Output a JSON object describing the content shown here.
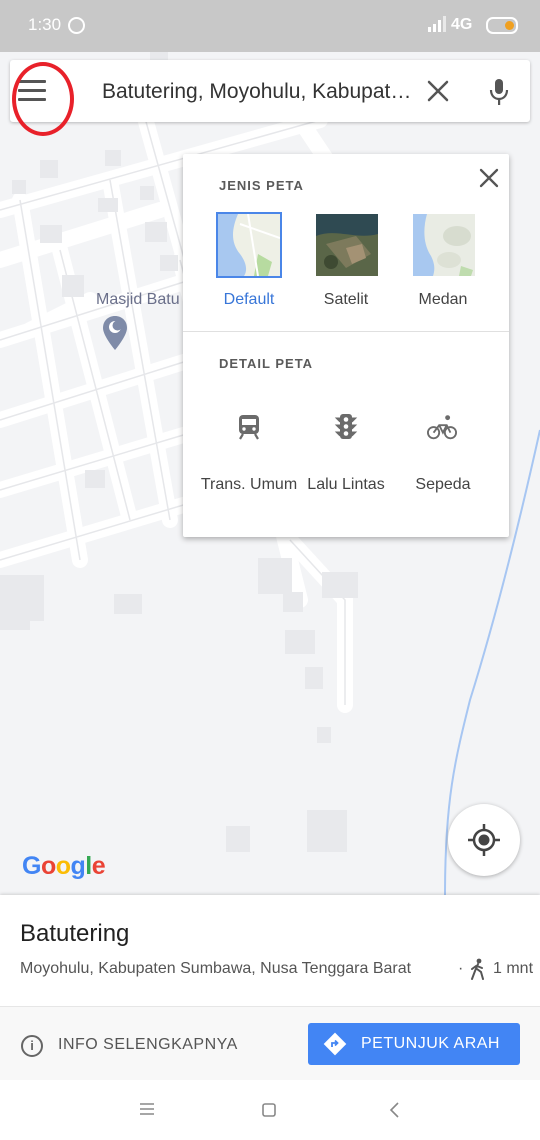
{
  "status_bar": {
    "time": "1:30",
    "network": "4G",
    "icons": [
      "hotspot-icon",
      "signal-icon",
      "battery-icon"
    ]
  },
  "search": {
    "query": "Batutering, Moyohulu, Kabupaten Sumbawa, Nusa Tenggara Barat",
    "icons": [
      "menu-icon",
      "close-icon",
      "mic-icon"
    ]
  },
  "map": {
    "poi_label": "Masjid Batu",
    "poi_icon": "mosque-pin-icon"
  },
  "layers_panel": {
    "map_type_title": "JENIS PETA",
    "map_types": [
      {
        "label": "Default",
        "selected": true
      },
      {
        "label": "Satelit",
        "selected": false
      },
      {
        "label": "Medan",
        "selected": false
      }
    ],
    "details_title": "DETAIL PETA",
    "details": [
      {
        "label": "Trans. Umum",
        "icon": "transit-icon"
      },
      {
        "label": "Lalu Lintas",
        "icon": "traffic-icon"
      },
      {
        "label": "Sepeda",
        "icon": "bicycle-icon"
      }
    ]
  },
  "google_logo": {
    "letters": [
      "G",
      "o",
      "o",
      "g",
      "l",
      "e"
    ],
    "colors": [
      "#4285F4",
      "#EA4335",
      "#FBBC05",
      "#4285F4",
      "#34A853",
      "#EA4335"
    ]
  },
  "place": {
    "title": "Batutering",
    "subtitle": "Moyohulu, Kabupaten Sumbawa, Nusa Tenggara Barat",
    "separator": "·",
    "walk_time": "1 mnt"
  },
  "actions": {
    "info_label": "INFO SELENGKAPNYA",
    "directions_label": "PETUNJUK ARAH"
  },
  "colors": {
    "accent": "#4285f4",
    "active_text": "#3876d8",
    "annotation_circle": "#e8212a"
  }
}
